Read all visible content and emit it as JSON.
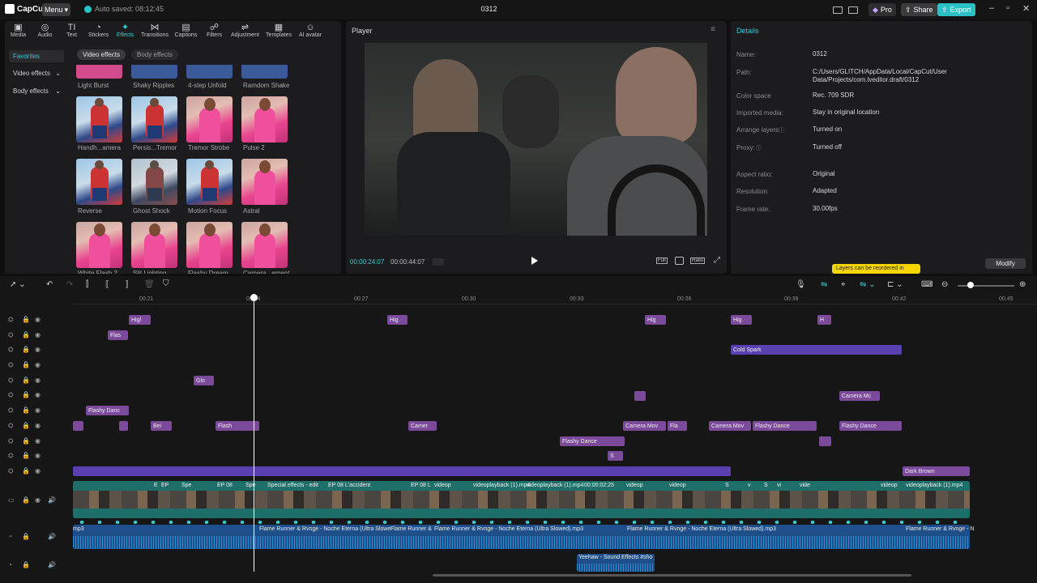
{
  "app": {
    "name": "CapCut",
    "menu_label": "Menu",
    "autosave": "Auto saved: 08:12:45",
    "project_title": "0312",
    "pro_label": "Pro",
    "share_label": "Share",
    "export_label": "Export"
  },
  "toolbar": {
    "tabs": [
      {
        "label": "Media",
        "icon": "media-icon"
      },
      {
        "label": "Audio",
        "icon": "audio-icon"
      },
      {
        "label": "Text",
        "icon": "text-icon"
      },
      {
        "label": "Stickers",
        "icon": "stickers-icon"
      },
      {
        "label": "Effects",
        "icon": "effects-icon"
      },
      {
        "label": "Transitions",
        "icon": "transitions-icon"
      },
      {
        "label": "Captions",
        "icon": "captions-icon"
      },
      {
        "label": "Filters",
        "icon": "filters-icon"
      },
      {
        "label": "Adjustment",
        "icon": "adjustment-icon"
      },
      {
        "label": "Templates",
        "icon": "templates-icon"
      },
      {
        "label": "AI avatar",
        "icon": "ai-avatar-icon"
      }
    ],
    "active": "Effects"
  },
  "effects_sidebar": {
    "items": [
      "Favorites",
      "Video effects",
      "Body effects"
    ]
  },
  "effects_subtabs": {
    "video": "Video effects",
    "body": "Body effects"
  },
  "effects_grid": {
    "row0": [
      "Light Burst",
      "Shaky Ripples",
      "4-step Unfold",
      "Ramdom Shake"
    ],
    "row1": [
      "Handh...amera",
      "Persis...Tremor",
      "Tremor Strobe",
      "Pulse 2"
    ],
    "row2": [
      "Reverse",
      "Ghost Shock",
      "Motion Focus",
      "Astral"
    ],
    "row3": [
      "White Flash 2",
      "Slit Lighting",
      "Flashy Dream",
      "Camera...ement"
    ]
  },
  "player": {
    "title": "Player",
    "current_time": "00:00:24:07",
    "total_time": "00:00:44:07",
    "full_label": "Full",
    "ratio_label": "Ratio"
  },
  "details": {
    "title": "Details",
    "rows": [
      {
        "label": "Name:",
        "value": "0312"
      },
      {
        "label": "Path:",
        "value": "C:/Users/GLITCH/AppData/Local/CapCut/User Data/Projects/com.lveditor.draft/0312"
      },
      {
        "label": "Color space",
        "value": "Rec. 709 SDR"
      },
      {
        "label": "Imported media:",
        "value": "Stay in original location"
      },
      {
        "label": "Arrange layers",
        "value": "Turned on"
      },
      {
        "label": "Proxy:",
        "value": "Turned off"
      },
      {
        "label": "Aspect ratio:",
        "value": "Original"
      },
      {
        "label": "Resolution:",
        "value": "Adapted"
      },
      {
        "label": "Frame rate:",
        "value": "30.00fps"
      }
    ],
    "tooltip": "Layers can be reordered in",
    "modify_label": "Modify"
  },
  "ruler": [
    "00:21",
    "00:24",
    "00:27",
    "00:30",
    "00:33",
    "00:36",
    "00:39",
    "00:42",
    "00:45"
  ],
  "effect_clips": [
    {
      "label": "Higl"
    },
    {
      "label": "Flas"
    },
    {
      "label": "Hig"
    },
    {
      "label": "Hig"
    },
    {
      "label": "Hig"
    },
    {
      "label": "H"
    },
    {
      "label": "Cold Spark"
    },
    {
      "label": "Glo"
    },
    {
      "label": ""
    },
    {
      "label": "Camera Mc"
    },
    {
      "label": "Flashy Danc"
    },
    {
      "label": ""
    },
    {
      "label": ""
    },
    {
      "label": "Bei"
    },
    {
      "label": "Flash"
    },
    {
      "label": "Camer"
    },
    {
      "label": "Camera Mov"
    },
    {
      "label": "Fla"
    },
    {
      "label": "Camera Mov"
    },
    {
      "label": "Flashy Dance"
    },
    {
      "label": "Flashy Dance"
    },
    {
      "label": "Flashy Dance"
    },
    {
      "label": ""
    },
    {
      "label": "S"
    },
    {
      "label": ""
    },
    {
      "label": "Dark Brown"
    }
  ],
  "video_track": {
    "labels": [
      "E",
      "EP",
      "Spe",
      "EP 08",
      "Spe",
      "Special effects - edit",
      "EP 08 L'accident",
      "EP 08 L",
      "videop",
      "videoplayback (1).mp4",
      "videoplayback (1).mp4",
      "00:00:02:25",
      "videop",
      "videop",
      "S",
      "v",
      "S",
      "vi",
      "vide",
      "videop",
      "videoplayback (1).mp4"
    ]
  },
  "audio_track": {
    "labels": [
      "mp3",
      "Flame Runner & Rvnge - Noche Eterna (Ultra Slowe",
      "Flame Runner &",
      "Flame Runner & Rvnge - Noche Eterna (Ultra Slowed).mp3",
      "Flame Runner & Rvnge - Noche Eterna (Ultra Slowed).mp3",
      "Flame Runner & Rvnge - N"
    ]
  },
  "sfx_track": {
    "label": "Yeehaw - Sound Effects  #sho"
  },
  "colors": {
    "accent": "#33c9d3",
    "effect_clip": "#7b4a9a",
    "filter_clip": "#5a3fb0",
    "video_track": "#1e6f6a",
    "audio_track": "#1f4f8a",
    "export": "#2bc0c4"
  }
}
